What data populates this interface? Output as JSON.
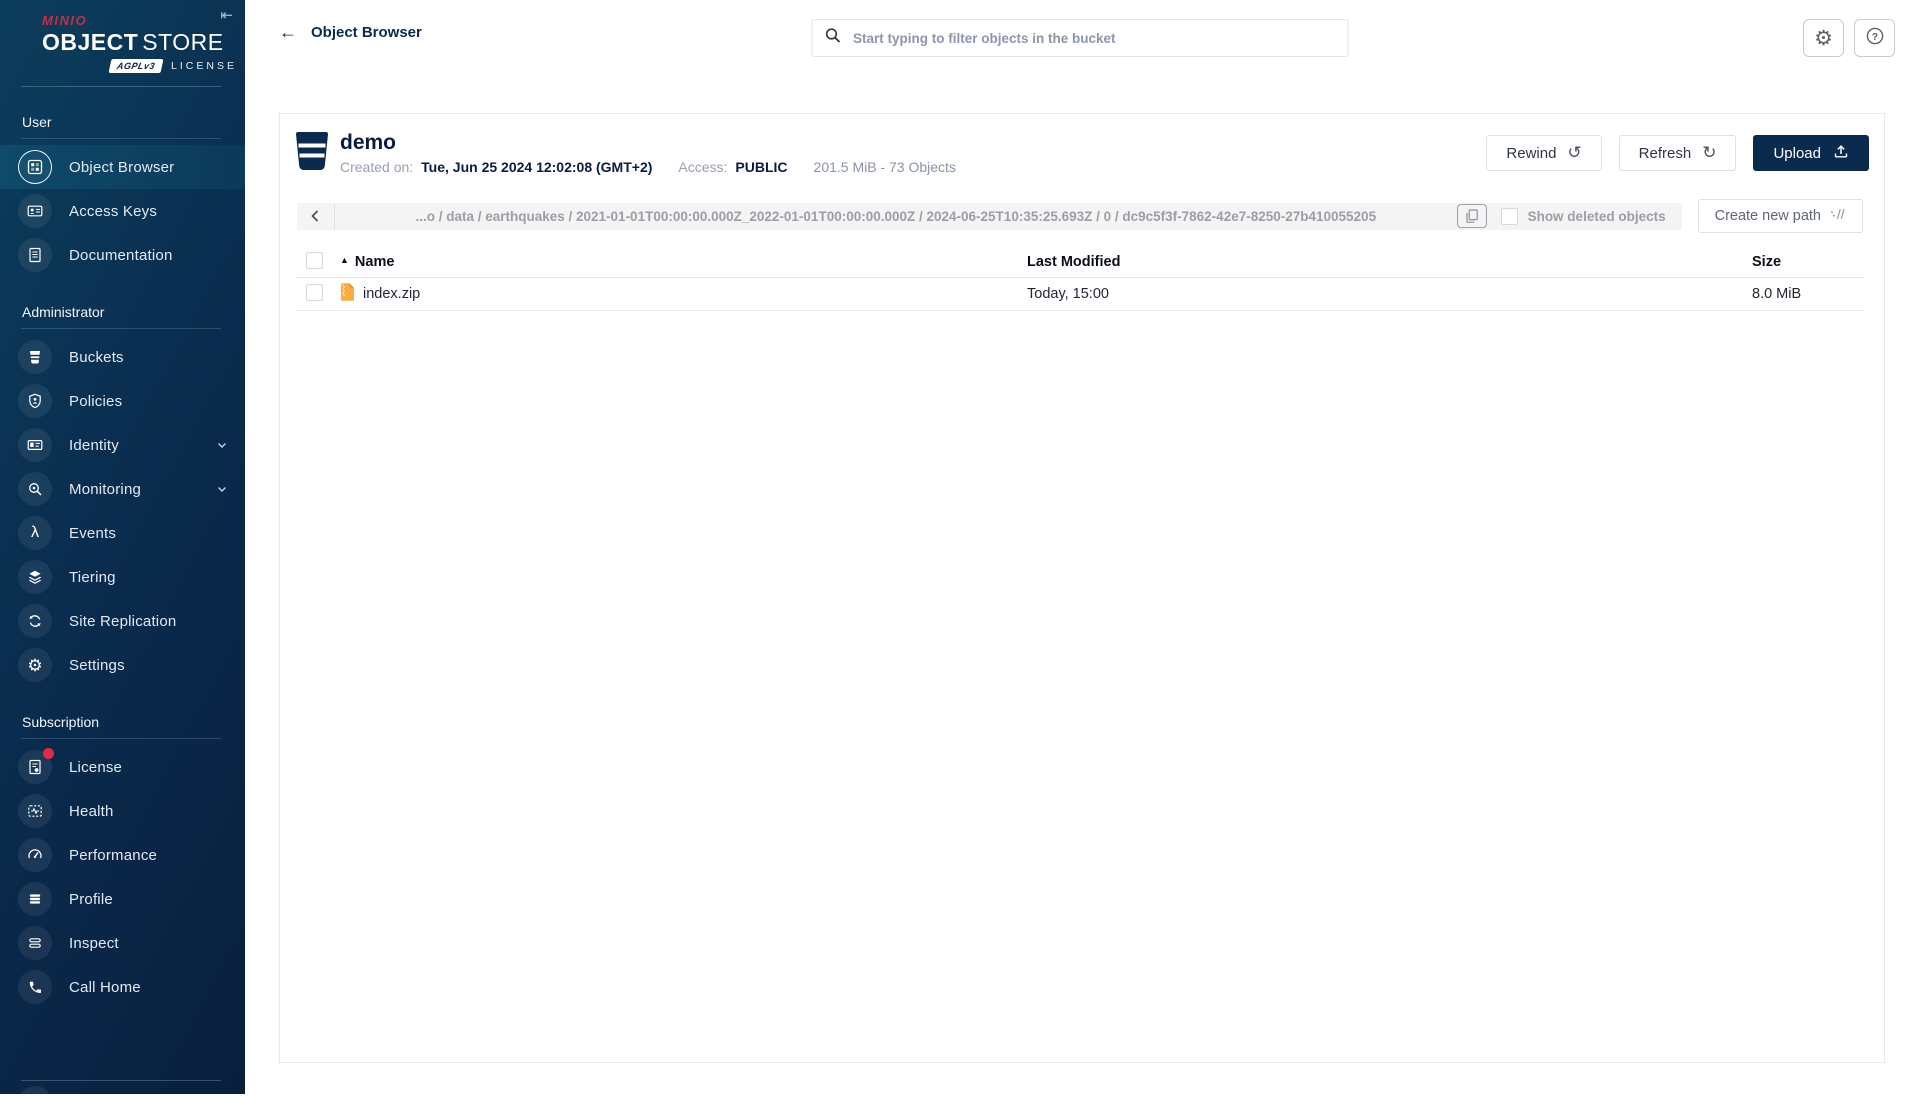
{
  "brand": {
    "name": "MINIO",
    "product_bold": "OBJECT",
    "product_light": "STORE",
    "badge": "AGPLv3",
    "license_word": "LICENSE"
  },
  "colors": {
    "brand_red": "#C72C48",
    "dark_navy": "#0A2B4E",
    "sidebar_selected": "#0E4A6B",
    "license_badge_dot": "#E1294B",
    "zip_icon": "#F9AB44"
  },
  "sidebar": {
    "sections": [
      {
        "label": "User",
        "items": [
          {
            "label": "Object Browser",
            "icon": "object-browser-icon",
            "selected": true
          },
          {
            "label": "Access Keys",
            "icon": "access-keys-icon"
          },
          {
            "label": "Documentation",
            "icon": "documentation-icon"
          }
        ]
      },
      {
        "label": "Administrator",
        "items": [
          {
            "label": "Buckets",
            "icon": "bucket-icon"
          },
          {
            "label": "Policies",
            "icon": "policies-icon"
          },
          {
            "label": "Identity",
            "icon": "identity-icon",
            "expandable": true
          },
          {
            "label": "Monitoring",
            "icon": "monitoring-icon",
            "expandable": true
          },
          {
            "label": "Events",
            "icon": "events-lambda-icon"
          },
          {
            "label": "Tiering",
            "icon": "tiering-layers-icon"
          },
          {
            "label": "Site Replication",
            "icon": "site-replication-icon"
          },
          {
            "label": "Settings",
            "icon": "settings-gear-icon"
          }
        ]
      },
      {
        "label": "Subscription",
        "items": [
          {
            "label": "License",
            "icon": "license-icon",
            "badge": "red-dot"
          },
          {
            "label": "Health",
            "icon": "health-icon"
          },
          {
            "label": "Performance",
            "icon": "performance-gauge-icon"
          },
          {
            "label": "Profile",
            "icon": "profile-icon"
          },
          {
            "label": "Inspect",
            "icon": "inspect-icon"
          },
          {
            "label": "Call Home",
            "icon": "call-home-phone-icon"
          }
        ]
      }
    ]
  },
  "topbar": {
    "title": "Object Browser",
    "search_placeholder": "Start typing to filter objects in the bucket"
  },
  "bucket": {
    "name": "demo",
    "created_label": "Created on:",
    "created_value": "Tue, Jun 25 2024 12:02:08 (GMT+2)",
    "access_label": "Access:",
    "access_value": "PUBLIC",
    "usage": "201.5 MiB - 73 Objects",
    "rewind_label": "Rewind",
    "refresh_label": "Refresh",
    "upload_label": "Upload"
  },
  "path_bar": {
    "path": "...o / data / earthquakes / 2021-01-01T00:00:00.000Z_2022-01-01T00:00:00.000Z / 2024-06-25T10:35:25.693Z / 0 / dc9c5f3f-7862-42e7-8250-27b410055205",
    "show_deleted_label": "Show deleted objects",
    "create_path_label": "Create new path"
  },
  "table": {
    "headers": {
      "name": "Name",
      "last_modified": "Last Modified",
      "size": "Size"
    },
    "rows": [
      {
        "name": "index.zip",
        "last_modified": "Today, 15:00",
        "size": "8.0 MiB"
      }
    ]
  }
}
